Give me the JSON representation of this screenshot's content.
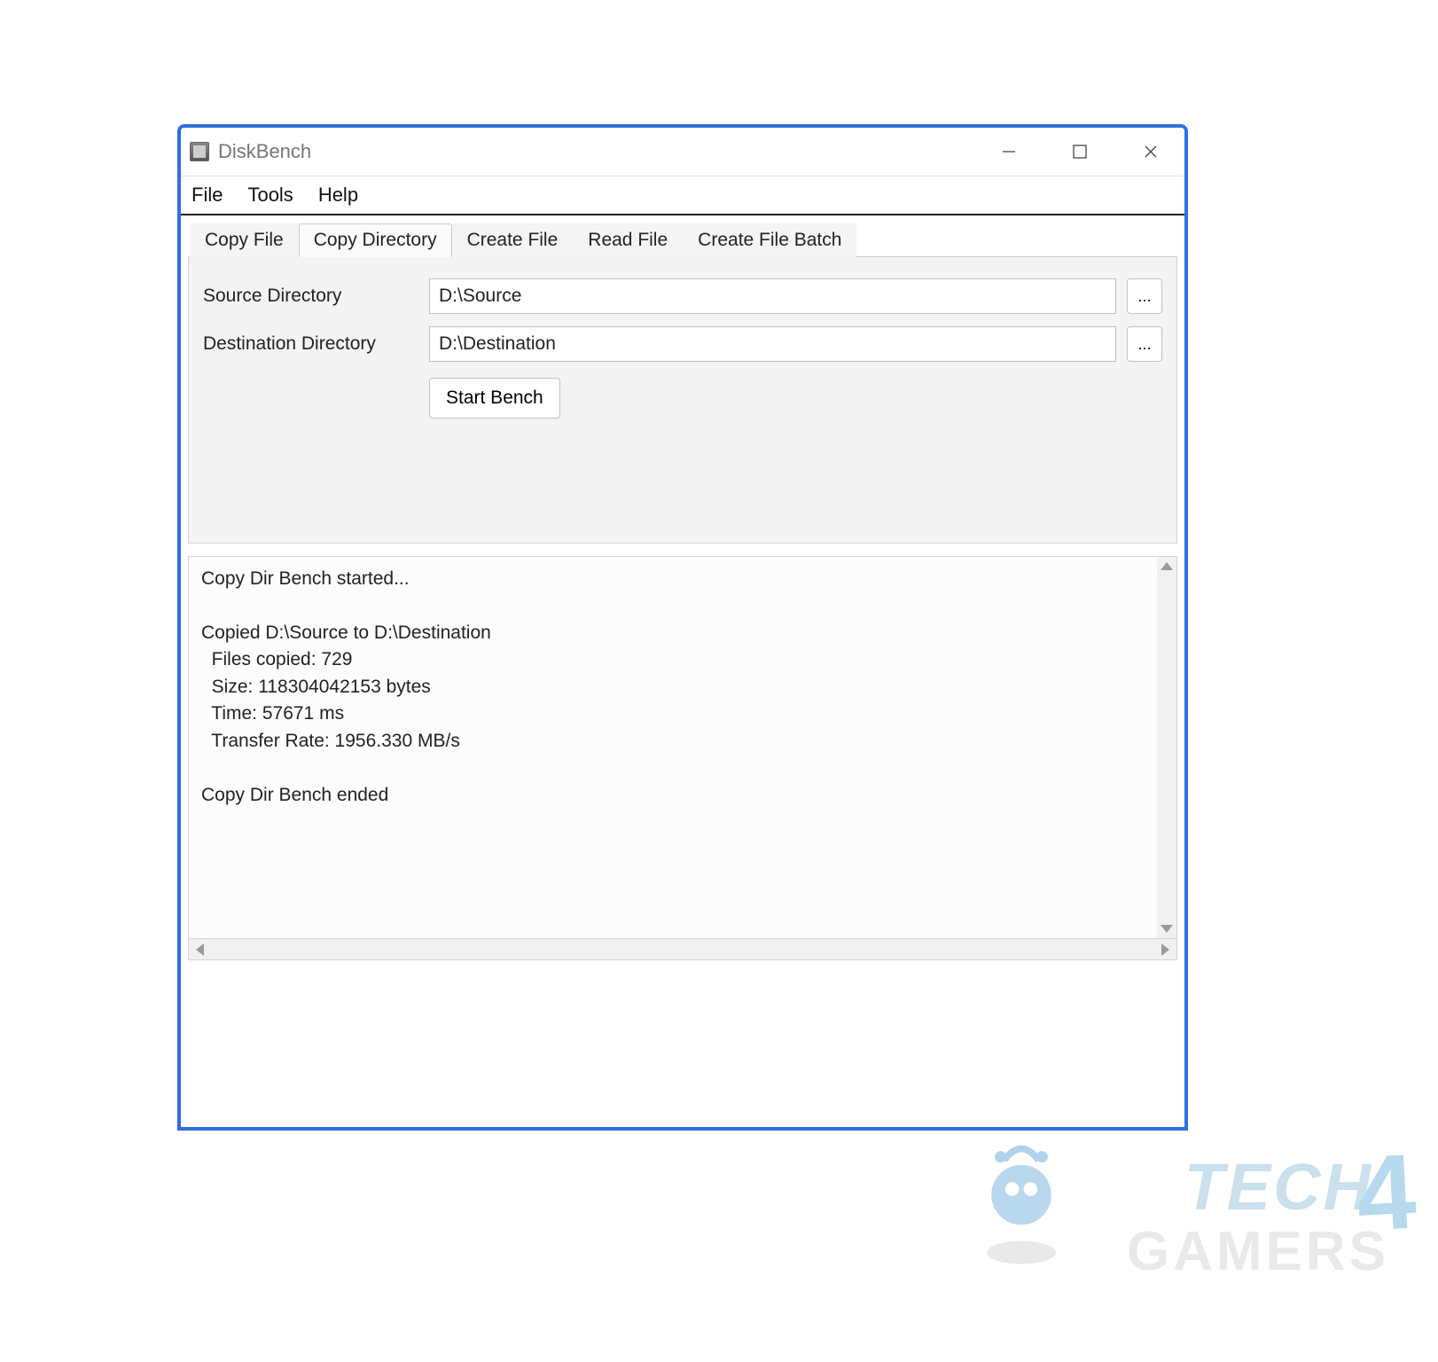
{
  "window": {
    "title": "DiskBench"
  },
  "menubar": {
    "items": [
      "File",
      "Tools",
      "Help"
    ]
  },
  "tabs": {
    "items": [
      "Copy File",
      "Copy Directory",
      "Create File",
      "Read File",
      "Create File Batch"
    ],
    "active_index": 1
  },
  "form": {
    "source_label": "Source Directory",
    "source_value": "D:\\Source",
    "destination_label": "Destination Directory",
    "destination_value": "D:\\Destination",
    "browse_label": "...",
    "start_label": "Start Bench"
  },
  "output": {
    "lines": [
      "Copy Dir Bench started...",
      "",
      "Copied D:\\Source to D:\\Destination",
      "  Files copied: 729",
      "  Size: 118304042153 bytes",
      "  Time: 57671 ms",
      "  Transfer Rate: 1956.330 MB/s",
      "",
      "Copy Dir Bench ended"
    ]
  },
  "watermark": {
    "top": "TECH",
    "four": "4",
    "bottom": "GAMERS"
  }
}
